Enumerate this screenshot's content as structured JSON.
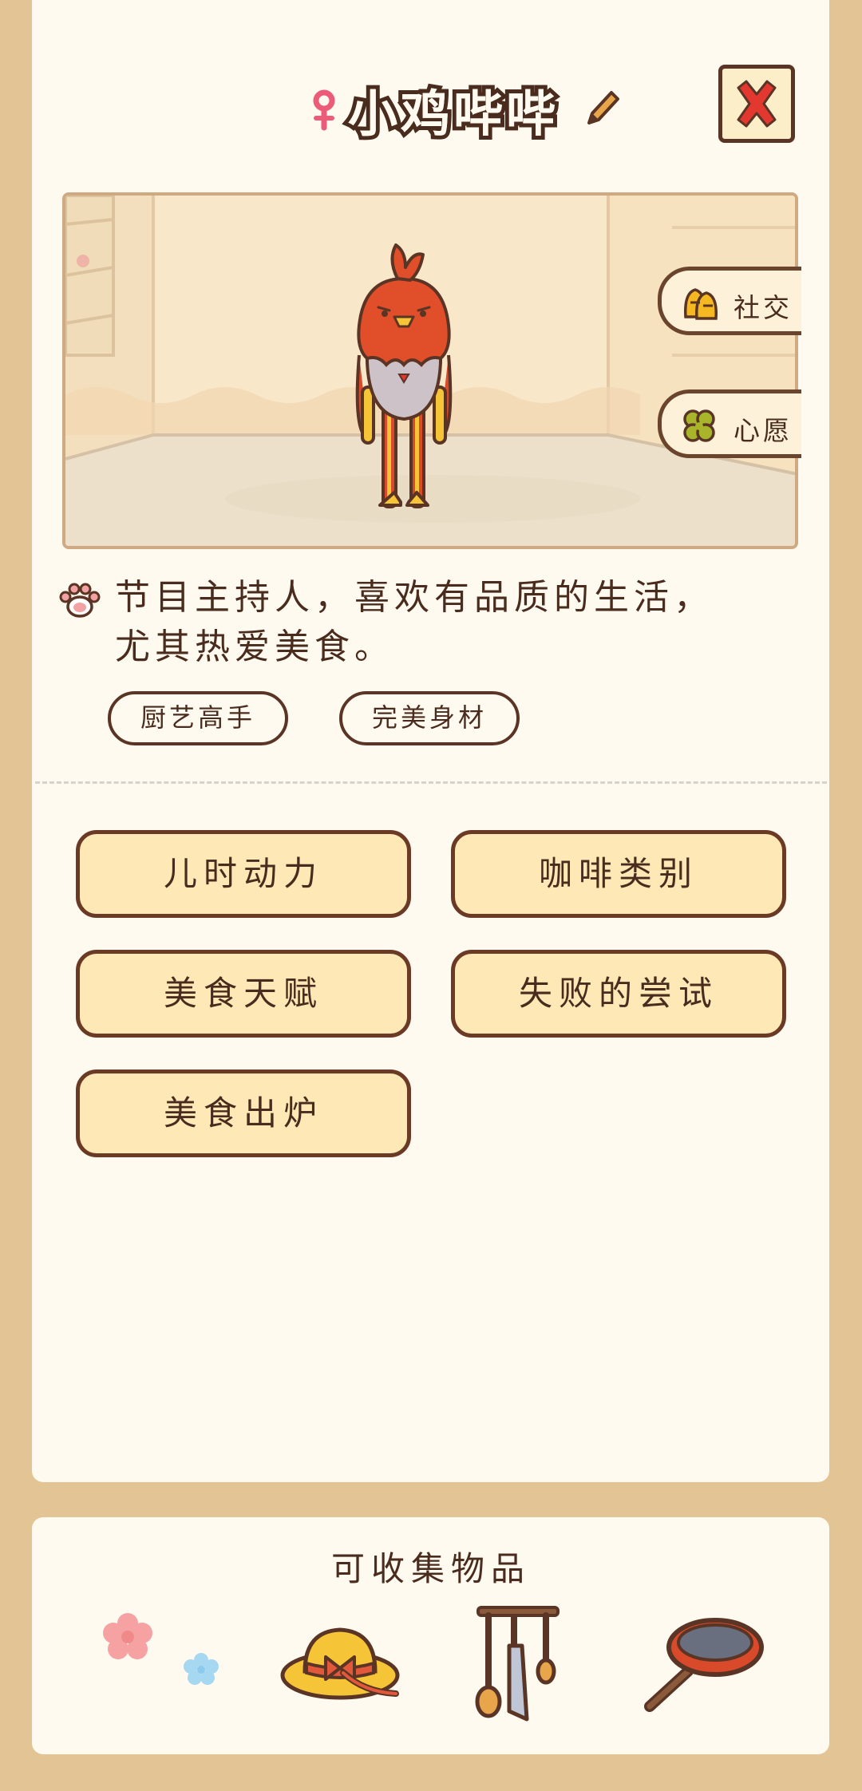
{
  "header": {
    "name": "小鸡哔哔",
    "gender": "female"
  },
  "scene": {
    "side_buttons": [
      {
        "label": "社交",
        "icon": "social-icon"
      },
      {
        "label": "心愿",
        "icon": "clover-icon"
      }
    ]
  },
  "profile": {
    "description_line1": "节目主持人，喜欢有品质的生活，",
    "description_line2": "尤其热爱美食。",
    "tags": [
      "厨艺高手",
      "完美身材"
    ]
  },
  "stories": [
    "儿时动力",
    "咖啡类别",
    "美食天赋",
    "失败的尝试",
    "美食出炉"
  ],
  "collectibles": {
    "title": "可收集物品",
    "items": [
      "flowers-icon",
      "straw-hat-icon",
      "kitchen-utensils-icon",
      "frying-pan-icon"
    ]
  },
  "colors": {
    "background": "#e3c494",
    "card": "#fffaf0",
    "button_fill": "#fde8b6",
    "outline": "#5a3424",
    "close_x": "#e2382f"
  }
}
